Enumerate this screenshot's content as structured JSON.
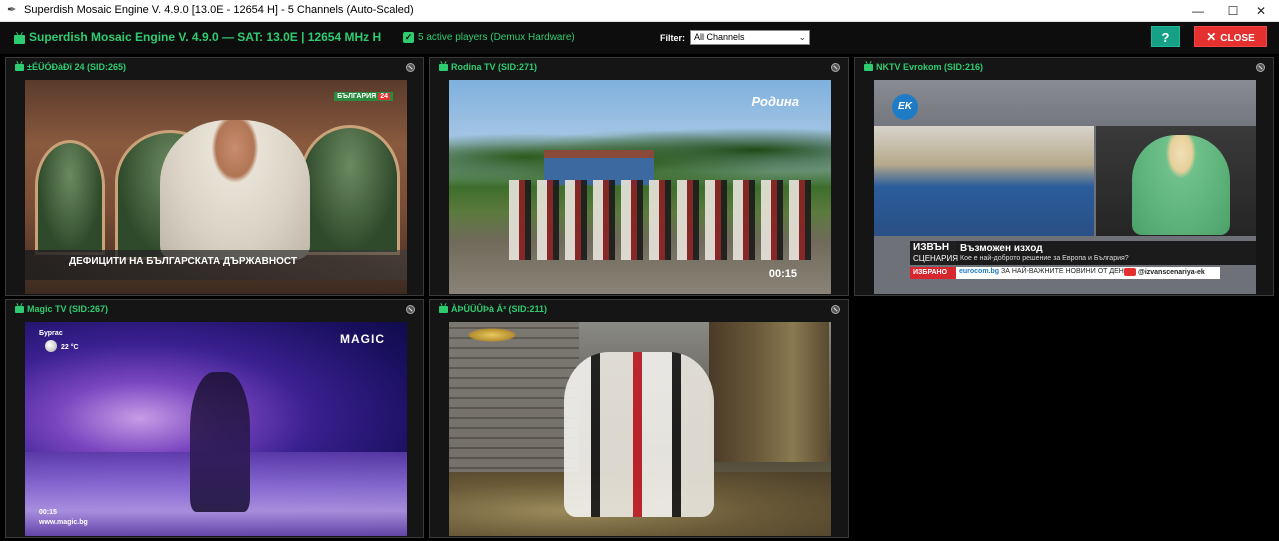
{
  "window": {
    "title": "Superdish Mosaic Engine V. 4.9.0 [13.0E - 12654 H] - 5 Channels (Auto-Scaled)",
    "minimize_glyph": "—",
    "maximize_glyph": "☐",
    "close_glyph": "✕"
  },
  "toolbar": {
    "title": "Superdish Mosaic Engine V. 4.9.0  —  SAT: 13.0E   |   12654 MHz H",
    "players_check_glyph": "✓",
    "players_label": "5 active players (Demux Hardware)",
    "filter_label": "Filter:",
    "filter_value": "All Channels",
    "filter_arrow": "⌄",
    "help_label": "?",
    "close_x": "✕",
    "close_label": "CLOSE"
  },
  "colors": {
    "accent": "#2ecc71",
    "help_button": "#16a085",
    "close_button": "#e53030",
    "panel_bg": "#151515"
  },
  "channels": [
    {
      "name": "±ÉÜÓÐàÐï 24 (SID:265)",
      "overlay": {
        "caption": "ДЕФИЦИТИ НА БЪЛГАРСКАТА ДЪРЖАВНОСТ",
        "logo": "БЪЛГАРИЯ",
        "logo_num": "24"
      }
    },
    {
      "name": "Rodina TV (SID:271)",
      "overlay": {
        "logo": "Родина",
        "time": "00:15"
      }
    },
    {
      "name": "NKTV Evrokom (SID:216)",
      "overlay": {
        "logo": "EK",
        "ticker_box_1": "ИЗВЪН",
        "ticker_box_2": "СЦЕНАРИЯ",
        "ticker_title": "Възможен изход",
        "ticker_sub": "Кое е най-доброто решение за Европа и България?",
        "strip_label": "ИЗБРАНО",
        "strip_site": "eurocom.bg",
        "strip_text": " ЗА НАЙ-ВАЖНИТЕ НОВИНИ ОТ ДЕНЯ",
        "strip_handle": "@izvanscenariya-ek"
      }
    },
    {
      "name": "Magic TV (SID:267)",
      "overlay": {
        "city": "Бургас",
        "temp": "22 °C",
        "logo": "MAGIC",
        "time": "00:15",
        "url": "www.magic.bg"
      }
    },
    {
      "name": "ÀÞÜÜÛÞà Á³ (SID:211)",
      "overlay": {}
    }
  ],
  "icons": {
    "app": "feather-icon",
    "tv": "tv-icon",
    "mute": "mute-icon",
    "check": "checkbox-checked-icon",
    "dropdown": "chevron-down-icon"
  }
}
